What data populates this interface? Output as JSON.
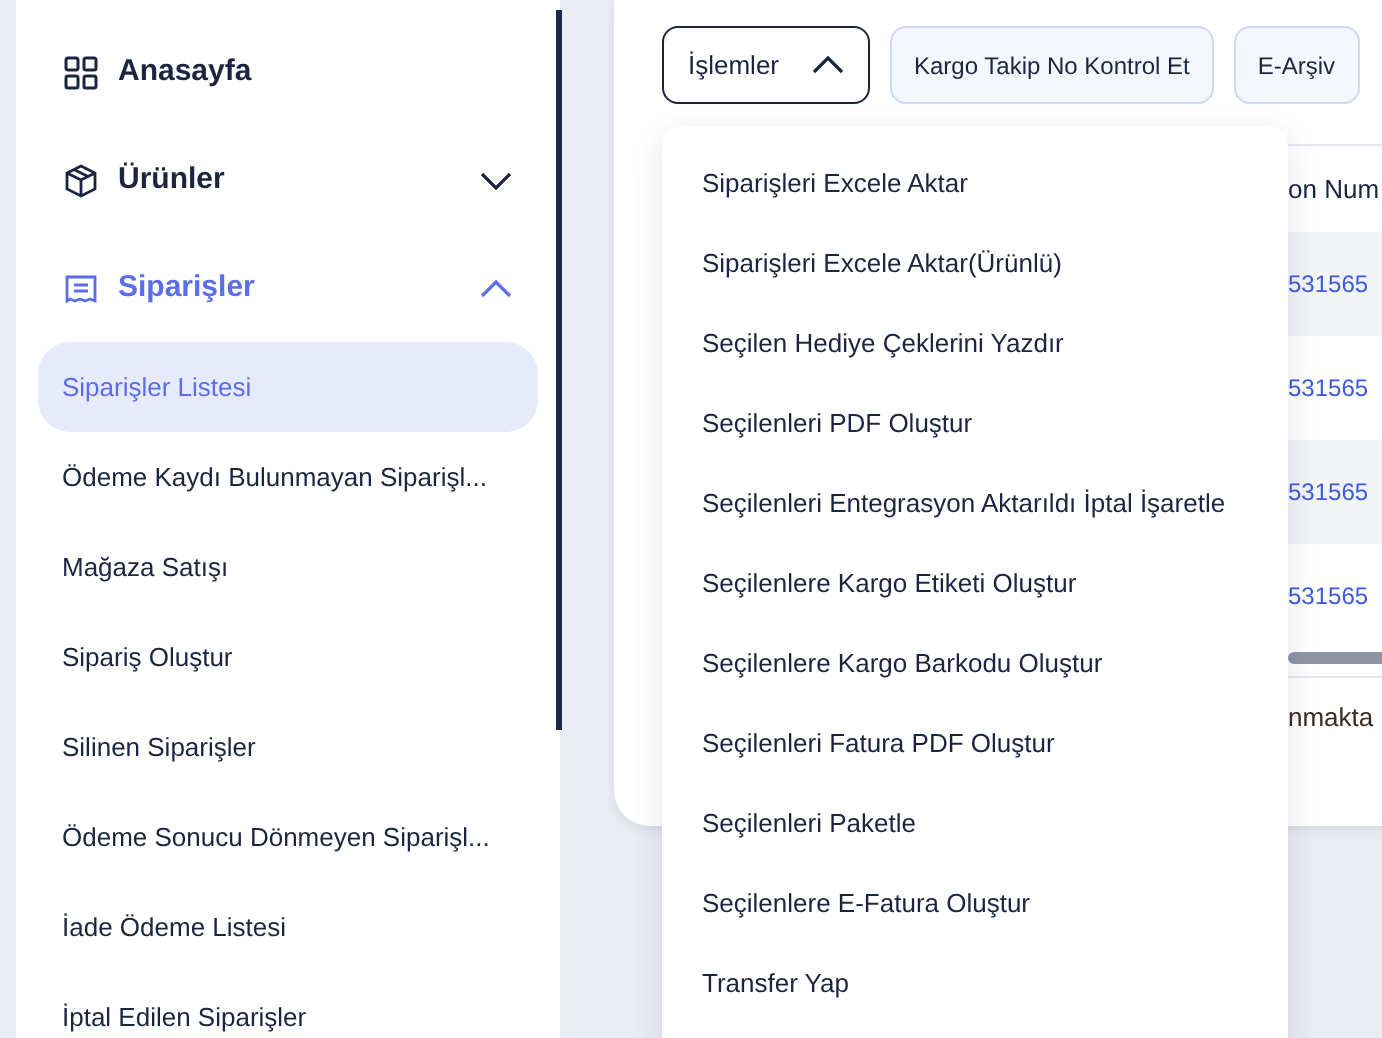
{
  "sidebar": {
    "items": [
      {
        "label": "Anasayfa",
        "selected": false
      },
      {
        "label": "Ürünler",
        "selected": false,
        "expanded": false
      },
      {
        "label": "Siparişler",
        "selected": true,
        "expanded": true,
        "children": [
          {
            "label": "Siparişler Listesi",
            "selected": true
          },
          {
            "label": "Ödeme Kaydı Bulunmayan Siparişl...",
            "selected": false
          },
          {
            "label": "Mağaza Satışı",
            "selected": false
          },
          {
            "label": "Sipariş Oluştur",
            "selected": false
          },
          {
            "label": "Silinen Siparişler",
            "selected": false
          },
          {
            "label": "Ödeme Sonucu Dönmeyen Siparişl...",
            "selected": false
          },
          {
            "label": "İade Ödeme Listesi",
            "selected": false
          },
          {
            "label": "İptal Edilen Siparişler",
            "selected": false
          }
        ]
      }
    ]
  },
  "toolbar": {
    "buttons": [
      {
        "kind": "dropdown",
        "label": "İşlemler",
        "expanded": true
      },
      {
        "kind": "button",
        "label": "Kargo Takip No Kontrol Et"
      },
      {
        "kind": "button",
        "label": "E-Arşiv"
      }
    ]
  },
  "table": {
    "column_1": "on Num",
    "rows": [
      {
        "column_1": "531565"
      },
      {
        "column_1": "531565"
      },
      {
        "column_1": "531565"
      },
      {
        "column_1": "531565"
      }
    ],
    "footer": "nmakta"
  },
  "menu": {
    "items": [
      "Siparişleri Excele Aktar",
      "Siparişleri Excele Aktar(Ürünlü)",
      "Seçilen Hediye Çeklerini Yazdır",
      "Seçilenleri PDF Oluştur",
      "Seçilenleri Entegrasyon Aktarıldı İptal İşaretle",
      "Seçilenlere Kargo Etiketi Oluştur",
      "Seçilenlere Kargo Barkodu Oluştur",
      "Seçilenleri Fatura PDF Oluştur",
      "Seçilenleri Paketle",
      "Seçilenlere E-Fatura Oluştur",
      "Transfer Yap"
    ]
  }
}
